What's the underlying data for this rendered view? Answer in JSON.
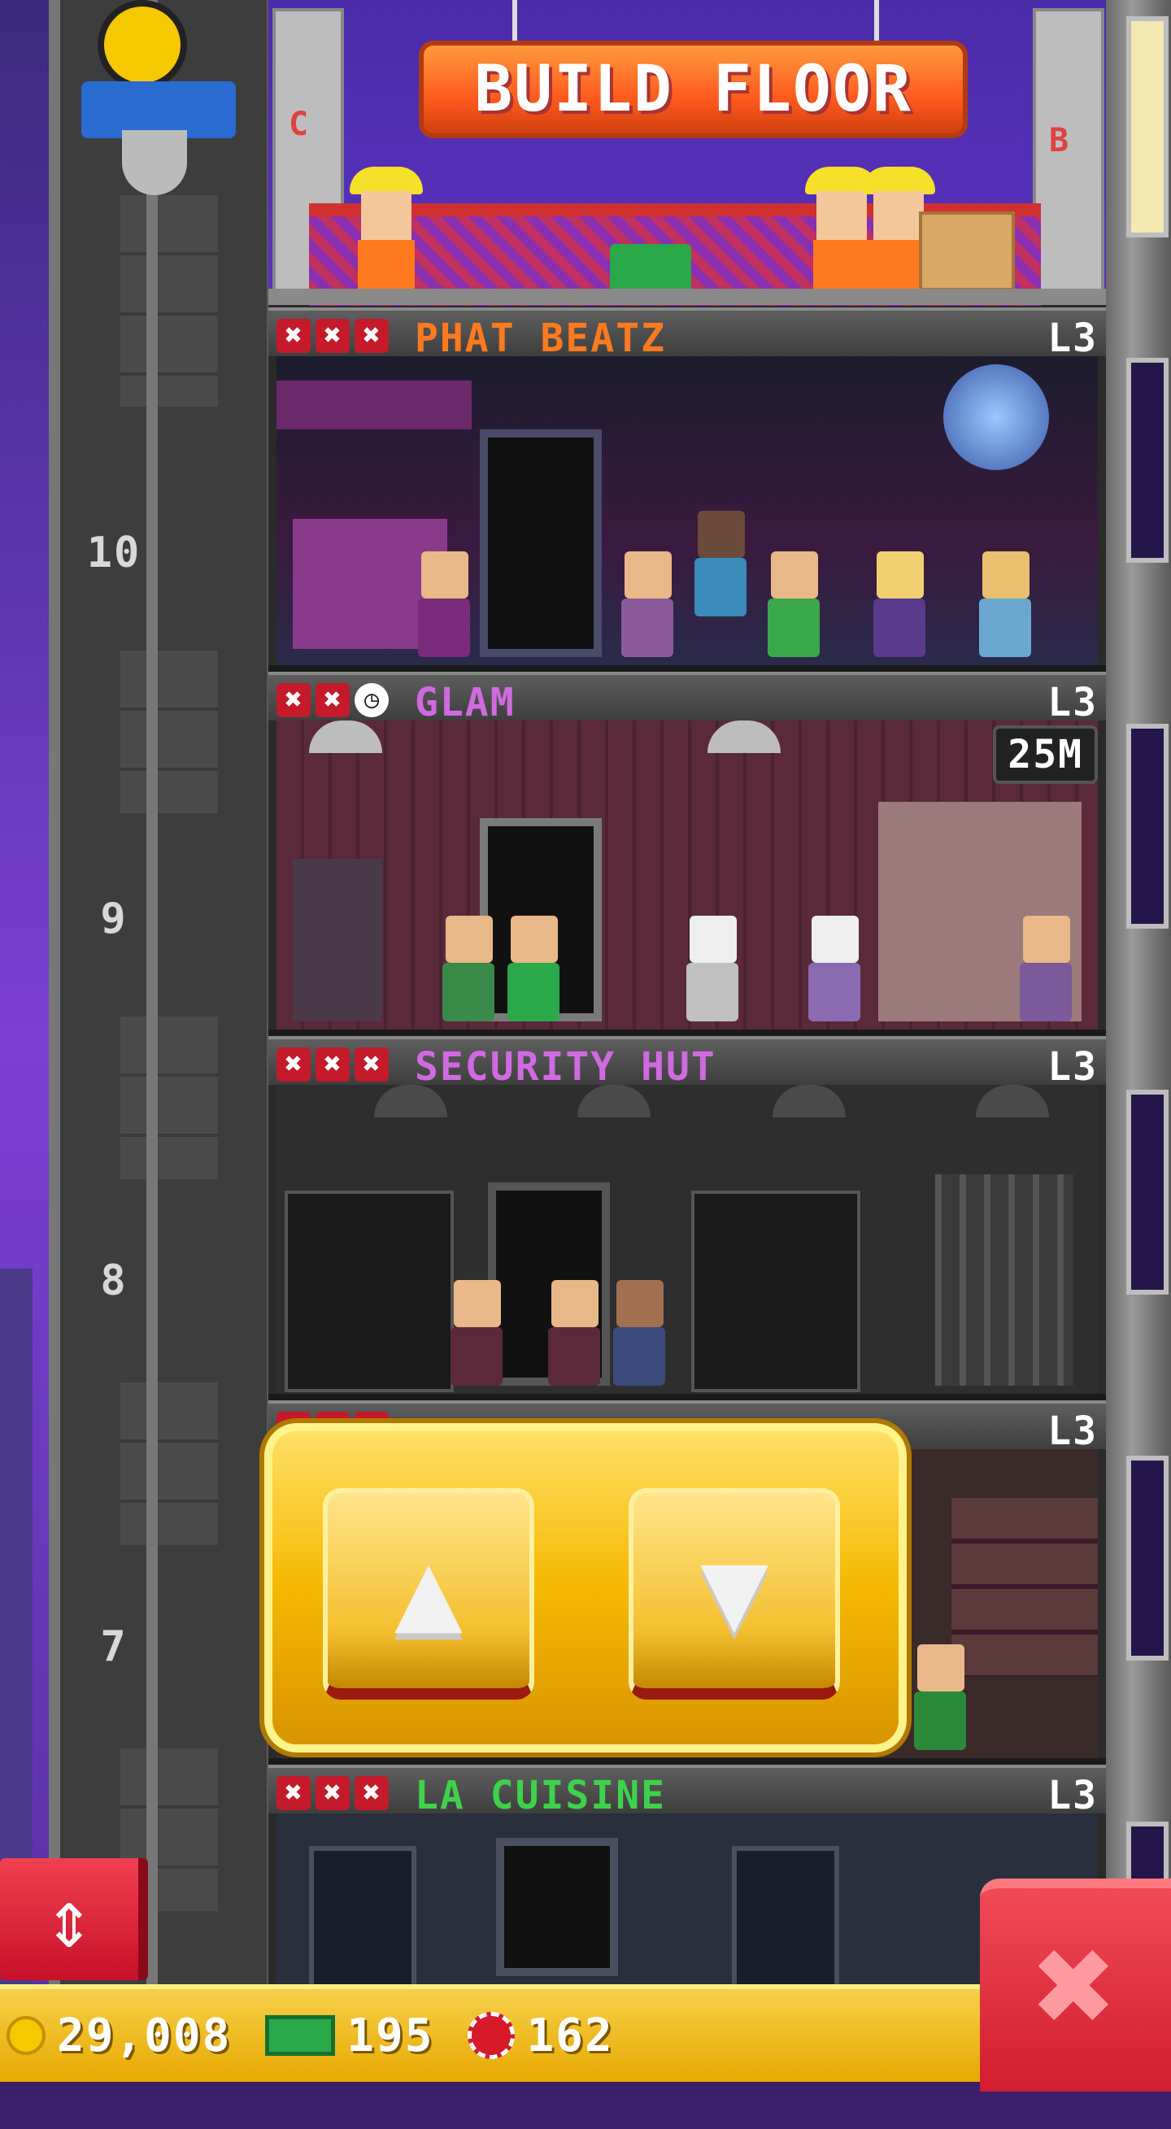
{
  "build": {
    "button_label": "BUILD FLOOR",
    "left_sign": "C",
    "right_sign": "B"
  },
  "shaft": {
    "floor_numbers": [
      "10",
      "9",
      "8",
      "7"
    ]
  },
  "floors": [
    {
      "name": "PHAT BEATZ",
      "level": "L3",
      "name_color": "#ff7a1f",
      "stars": [
        "x",
        "x",
        "x"
      ]
    },
    {
      "name": "GLAM",
      "level": "L3",
      "name_color": "#d06ae0",
      "stars": [
        "x",
        "x",
        "clock"
      ],
      "timer": "25M"
    },
    {
      "name": "SECURITY HUT",
      "level": "L3",
      "name_color": "#d06ae0",
      "stars": [
        "x",
        "x",
        "x"
      ]
    },
    {
      "name": "",
      "level": "L3",
      "name_color": "#3ed24a",
      "stars": [
        "x",
        "x",
        "x"
      ]
    },
    {
      "name": "LA CUISINE",
      "level": "L3",
      "name_color": "#3ed24a",
      "stars": [
        "x",
        "x",
        "x"
      ]
    }
  ],
  "controls": {
    "up_label": "▲",
    "down_label": "▼",
    "elevator_toggle": "⇕",
    "close": "✖"
  },
  "resources": {
    "coins": "29,008",
    "bux": "195",
    "tokens": "162"
  }
}
